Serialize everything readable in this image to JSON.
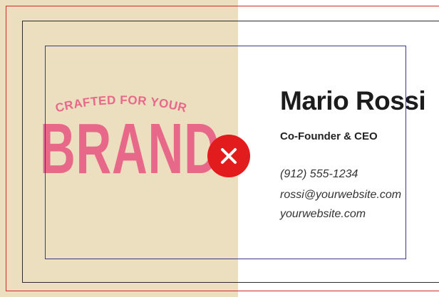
{
  "card": {
    "tagline": "- CRAFTED FOR YOUR -",
    "brand": "BRAND",
    "name": "Mario Rossi",
    "title": "Co-Founder & CEO",
    "phone": "(912) 555-1234",
    "email": "rossi@yourwebsite.com",
    "website": "yourwebsite.com"
  },
  "colors": {
    "left_panel": "#ecdfbf",
    "brand_pink": "#e8688a",
    "bleed_line": "#d22a2a",
    "safe_line": "#3b3a8a",
    "error_red": "#e21c1c"
  },
  "icons": {
    "error": "close-icon"
  }
}
